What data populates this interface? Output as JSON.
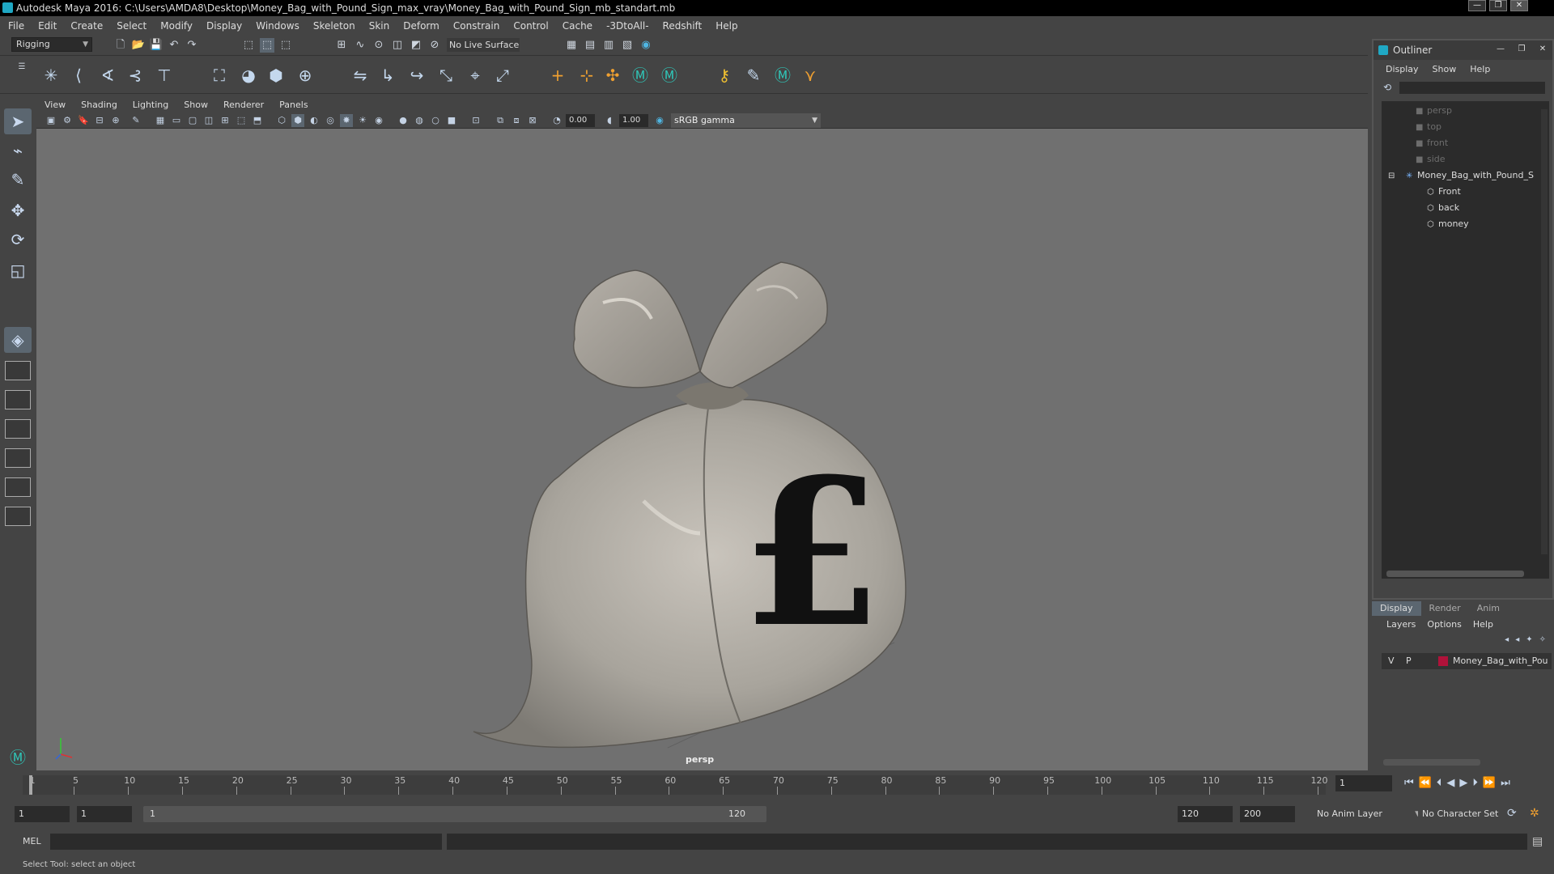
{
  "window": {
    "title": "Autodesk Maya 2016: C:\\Users\\AMDA8\\Desktop\\Money_Bag_with_Pound_Sign_max_vray\\Money_Bag_with_Pound_Sign_mb_standart.mb"
  },
  "menubar": [
    "File",
    "Edit",
    "Create",
    "Select",
    "Modify",
    "Display",
    "Windows",
    "Skeleton",
    "Skin",
    "Deform",
    "Constrain",
    "Control",
    "Cache",
    "-3DtoAll-",
    "Redshift",
    "Help"
  ],
  "shelf": {
    "mode": "Rigging",
    "live_surface": "No Live Surface"
  },
  "panel": {
    "menus": [
      "View",
      "Shading",
      "Lighting",
      "Show",
      "Renderer",
      "Panels"
    ],
    "exposure": "0.00",
    "gamma": "1.00",
    "color_space": "sRGB gamma",
    "camera": "persp"
  },
  "outliner": {
    "title": "Outliner",
    "menus": [
      "Display",
      "Show",
      "Help"
    ],
    "items": [
      {
        "label": "persp",
        "icon": "camera-icon"
      },
      {
        "label": "top",
        "icon": "camera-icon"
      },
      {
        "label": "front",
        "icon": "camera-icon"
      },
      {
        "label": "side",
        "icon": "camera-icon"
      },
      {
        "label": "Money_Bag_with_Pound_S",
        "icon": "group-icon"
      },
      {
        "label": "Front",
        "icon": "mesh-icon"
      },
      {
        "label": "back",
        "icon": "mesh-icon"
      },
      {
        "label": "money",
        "icon": "mesh-icon"
      }
    ]
  },
  "channelbox": {
    "tabs": [
      "Display",
      "Render",
      "Anim"
    ],
    "menus": [
      "Layers",
      "Options",
      "Help"
    ],
    "layer": {
      "v": "V",
      "p": "P",
      "name": "Money_Bag_with_Pou",
      "color": "#b0123a"
    }
  },
  "timeline": {
    "labels": [
      "1",
      "5",
      "10",
      "15",
      "20",
      "25",
      "30",
      "35",
      "40",
      "45",
      "50",
      "55",
      "60",
      "65",
      "70",
      "75",
      "80",
      "85",
      "90",
      "95",
      "100",
      "105",
      "110",
      "115",
      "120"
    ],
    "current_frame": "1"
  },
  "range": {
    "start": "1",
    "playback_start": "1",
    "slider_start": "1",
    "slider_end": "120",
    "playback_end": "120",
    "end": "200",
    "anim_layer": "No Anim Layer",
    "character_set": "No Character Set"
  },
  "command": {
    "label": "MEL"
  },
  "help_line": "Select Tool: select an object"
}
